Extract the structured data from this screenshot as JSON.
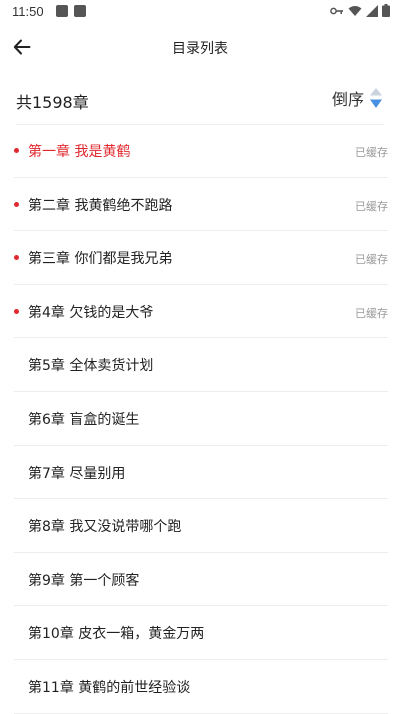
{
  "status_bar": {
    "time": "11:50"
  },
  "header": {
    "back_icon": "arrow-left-icon",
    "title": "目录列表"
  },
  "summary": {
    "total_label": "共1598章",
    "sort_label": "倒序",
    "sort_icon": "sort-arrows-icon"
  },
  "colors": {
    "accent_red": "#e0282e",
    "sort_blue": "#4a90e2",
    "divider": "#ededed"
  },
  "chapters": [
    {
      "title": "第一章 我是黄鹤",
      "status": "已缓存",
      "has_dot": true,
      "current": true
    },
    {
      "title": "第二章 我黄鹤绝不跑路",
      "status": "已缓存",
      "has_dot": true,
      "current": false
    },
    {
      "title": "第三章 你们都是我兄弟",
      "status": "已缓存",
      "has_dot": true,
      "current": false
    },
    {
      "title": "第4章 欠钱的是大爷",
      "status": "已缓存",
      "has_dot": true,
      "current": false
    },
    {
      "title": "第5章 全体卖货计划",
      "status": "",
      "has_dot": false,
      "current": false
    },
    {
      "title": "第6章 盲盒的诞生",
      "status": "",
      "has_dot": false,
      "current": false
    },
    {
      "title": "第7章 尽量别用",
      "status": "",
      "has_dot": false,
      "current": false
    },
    {
      "title": "第8章 我又没说带哪个跑",
      "status": "",
      "has_dot": false,
      "current": false
    },
    {
      "title": "第9章 第一个顾客",
      "status": "",
      "has_dot": false,
      "current": false
    },
    {
      "title": "第10章 皮衣一箱，黄金万两",
      "status": "",
      "has_dot": false,
      "current": false
    },
    {
      "title": "第11章 黄鹤的前世经验谈",
      "status": "",
      "has_dot": false,
      "current": false
    }
  ]
}
